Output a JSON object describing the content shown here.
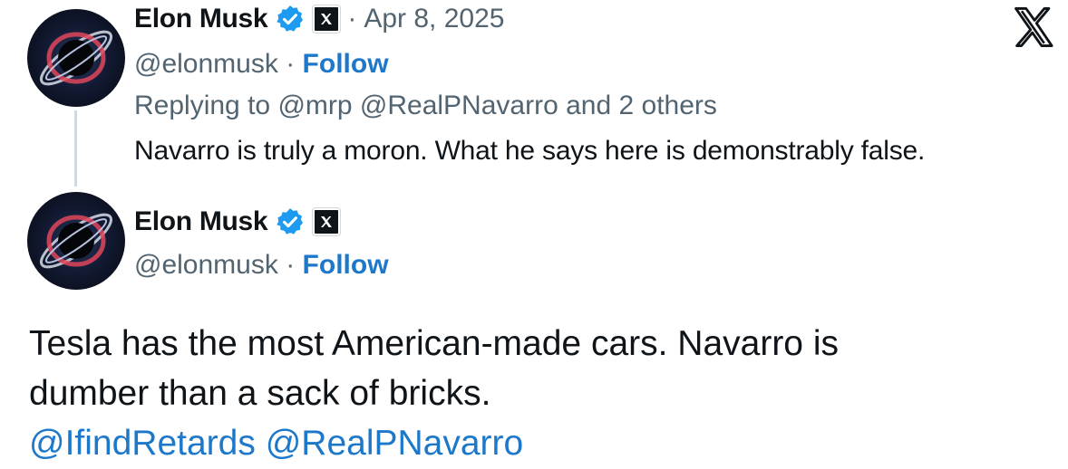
{
  "top_tweet": {
    "author_name": "Elon Musk",
    "handle": "@elonmusk",
    "separator": "·",
    "follow_label": "Follow",
    "date": "Apr 8, 2025",
    "reply_prefix": "Replying to",
    "reply_targets": "@mrp @RealPNavarro",
    "reply_suffix": "and 2 others",
    "text": "Navarro is truly a moron. What he says here is demonstrably false."
  },
  "quoted_tweet": {
    "author_name": "Elon Musk",
    "handle": "@elonmusk",
    "separator": "·",
    "follow_label": "Follow",
    "text_line1": "Tesla has the most American-made cars. Navarro is",
    "text_line2": "dumber than a sack of bricks.",
    "mentions": "@IfindRetards @RealPNavarro"
  },
  "icons": {
    "verified": "verified-badge-icon",
    "x_affiliation": "x-affiliation-icon",
    "x_logo": "x-logo-icon",
    "avatar": "avatar-black-hole"
  },
  "colors": {
    "link_blue": "#1d78c9",
    "verified_blue": "#1d9bf0",
    "secondary_text": "#536471",
    "thread_line": "#cfd9de"
  }
}
